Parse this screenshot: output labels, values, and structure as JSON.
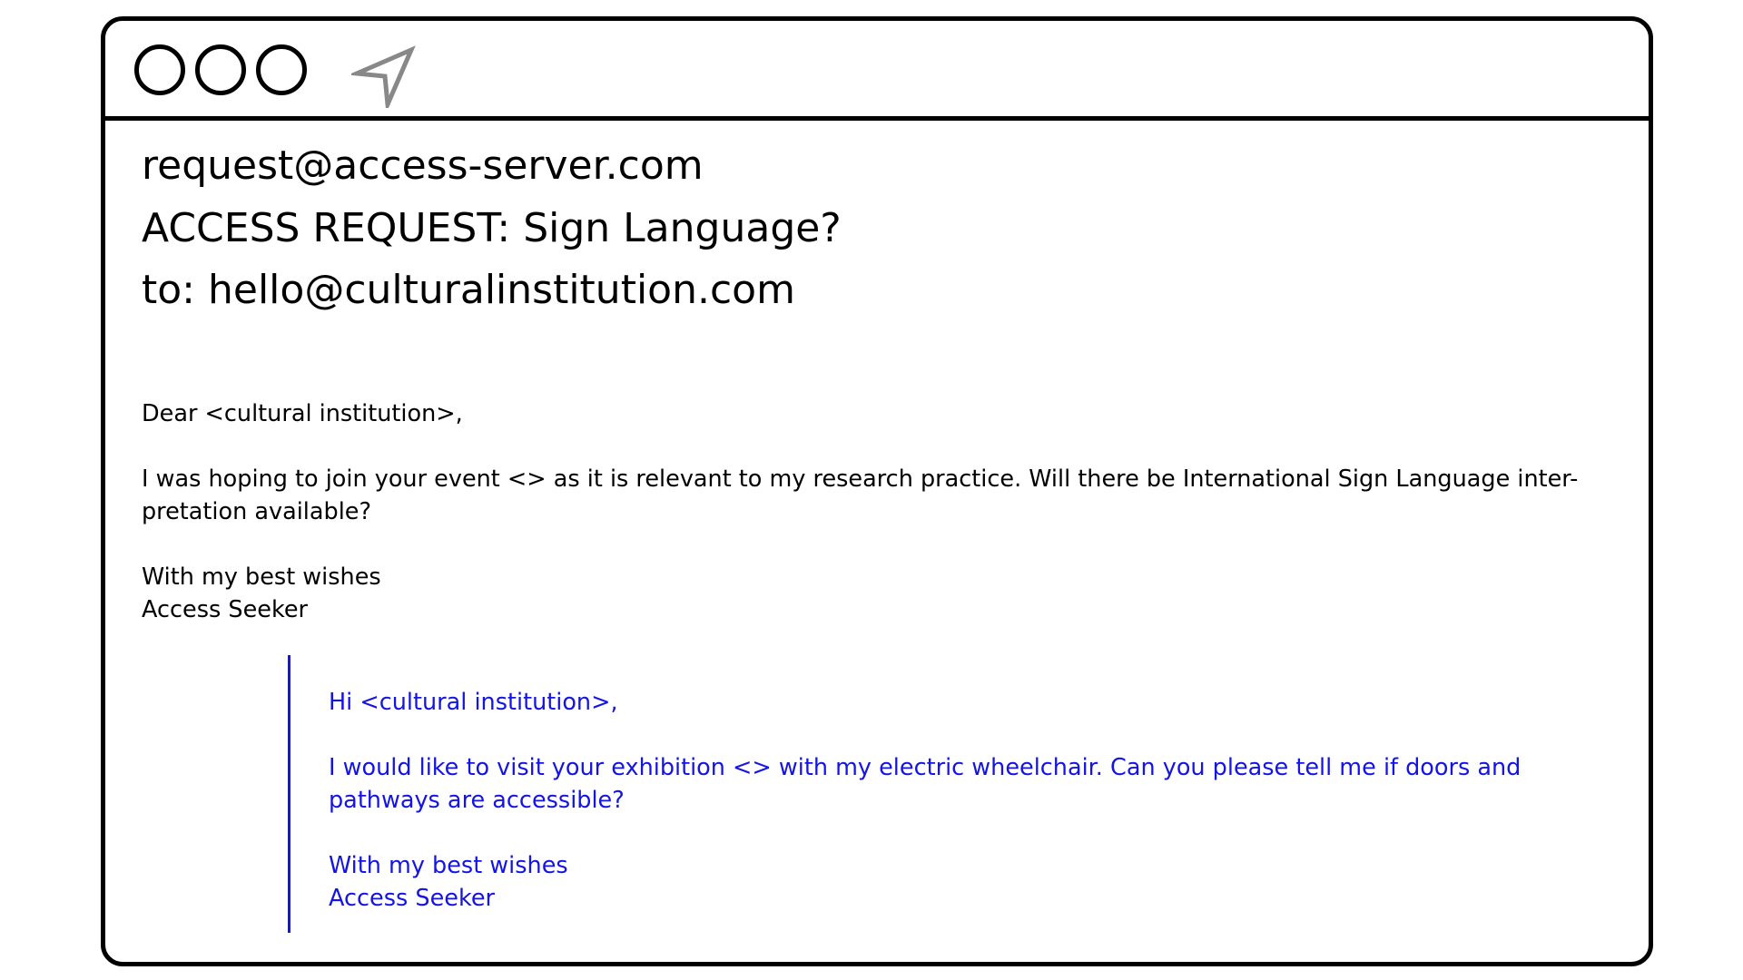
{
  "window": {
    "controls": [
      "circle-button",
      "circle-button",
      "circle-button"
    ],
    "send_icon": "send-arrow-icon"
  },
  "email": {
    "from": "request@access-server.com",
    "subject": "ACCESS REQUEST: Sign Language?",
    "to_label": "to:",
    "to_address": "hello@culturalinstitution.com",
    "greeting": "Dear <cultural institution>,",
    "paragraph_line1": "I was hoping to join your event <> as it is relevant to my research practice. Will there be International Sign Language inter-",
    "paragraph_line2": "pretation available?",
    "signoff_line1": "With my best wishes",
    "signoff_line2": "Access Seeker"
  },
  "reply": {
    "greeting": "Hi <cultural institution>,",
    "paragraph_line1": "I would like to visit your exhibition <> with my electric wheelchair. Can you please tell me if doors and",
    "paragraph_line2": "pathways are accessible?",
    "signoff_line1": "With my best wishes",
    "signoff_line2": "Access Seeker"
  },
  "colors": {
    "border": "#000000",
    "reply_text": "#1414e6",
    "send_icon": "#888888"
  }
}
